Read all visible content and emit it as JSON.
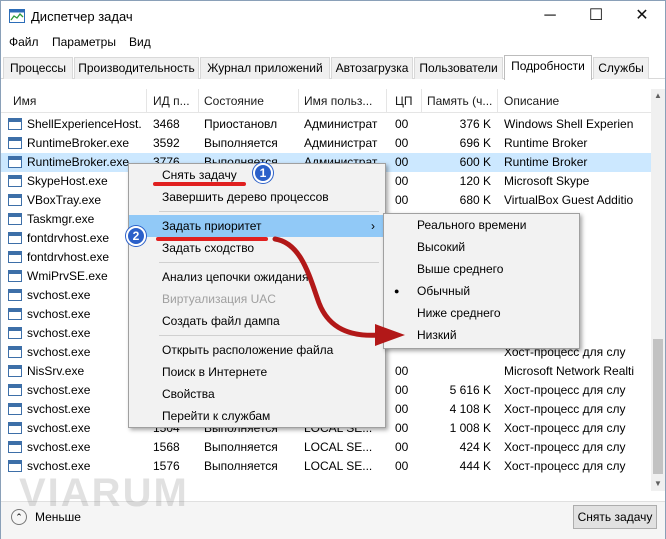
{
  "window": {
    "title": "Диспетчер задач",
    "minimize": "─",
    "maximize": "☐",
    "close": "✕"
  },
  "menu": [
    "Файл",
    "Параметры",
    "Вид"
  ],
  "tabs": [
    "Процессы",
    "Производительность",
    "Журнал приложений",
    "Автозагрузка",
    "Пользователи",
    "Подробности",
    "Службы"
  ],
  "active_tab": "Подробности",
  "columns": [
    "Имя",
    "ИД п...",
    "Состояние",
    "Имя польз...",
    "ЦП",
    "Память (ч...",
    "Описание"
  ],
  "rows": [
    {
      "name": "ShellExperienceHost.",
      "pid": "3468",
      "state": "Приостановл",
      "user": "Администрат",
      "cpu": "00",
      "mem": "376 K",
      "desc": "Windows Shell Experien"
    },
    {
      "name": "RuntimeBroker.exe",
      "pid": "3592",
      "state": "Выполняется",
      "user": "Администрат",
      "cpu": "00",
      "mem": "696 K",
      "desc": "Runtime Broker"
    },
    {
      "name": "RuntimeBroker.exe",
      "pid": "3776",
      "state": "Выполняется",
      "user": "Администрат",
      "cpu": "00",
      "mem": "600 K",
      "desc": "Runtime Broker"
    },
    {
      "name": "SkypeHost.exe",
      "pid": "",
      "state": "",
      "user": "",
      "cpu": "00",
      "mem": "120 K",
      "desc": "Microsoft Skype"
    },
    {
      "name": "VBoxTray.exe",
      "pid": "",
      "state": "",
      "user": "",
      "cpu": "00",
      "mem": "680 K",
      "desc": "VirtualBox Guest Additio"
    },
    {
      "name": "Taskmgr.exe",
      "pid": "",
      "state": "",
      "user": "",
      "cpu": "",
      "mem": "",
      "desc": "ер задач"
    },
    {
      "name": "fontdrvhost.exe",
      "pid": "",
      "state": "",
      "user": "",
      "cpu": "",
      "mem": "",
      "desc": "Driver H"
    },
    {
      "name": "fontdrvhost.exe",
      "pid": "",
      "state": "",
      "user": "",
      "cpu": "",
      "mem": "",
      "desc": "Driver H"
    },
    {
      "name": "WmiPrvSE.exe",
      "pid": "",
      "state": "",
      "user": "",
      "cpu": "",
      "mem": "",
      "desc": "Host"
    },
    {
      "name": "svchost.exe",
      "pid": "",
      "state": "",
      "user": "",
      "cpu": "",
      "mem": "",
      "desc": "сс для слу"
    },
    {
      "name": "svchost.exe",
      "pid": "",
      "state": "",
      "user": "",
      "cpu": "",
      "mem": "",
      "desc": "сс для слу"
    },
    {
      "name": "svchost.exe",
      "pid": "",
      "state": "",
      "user": "",
      "cpu": "",
      "mem": "",
      "desc": "сс для слу"
    },
    {
      "name": "svchost.exe",
      "pid": "",
      "state": "",
      "user": "",
      "cpu": "",
      "mem": "",
      "desc": "Хост-процесс для слу"
    },
    {
      "name": "NisSrv.exe",
      "pid": "",
      "state": "",
      "user": "",
      "cpu": "00",
      "mem": "",
      "desc": "Microsoft Network Realti"
    },
    {
      "name": "svchost.exe",
      "pid": "",
      "state": "",
      "user": "",
      "cpu": "00",
      "mem": "5 616 K",
      "desc": "Хост-процесс для слу"
    },
    {
      "name": "svchost.exe",
      "pid": "",
      "state": "",
      "user": "",
      "cpu": "00",
      "mem": "4 108 K",
      "desc": "Хост-процесс для слу"
    },
    {
      "name": "svchost.exe",
      "pid": "1504",
      "state": "Выполняется",
      "user": "LOCAL SE...",
      "cpu": "00",
      "mem": "1 008 K",
      "desc": "Хост-процесс для слу"
    },
    {
      "name": "svchost.exe",
      "pid": "1568",
      "state": "Выполняется",
      "user": "LOCAL SE...",
      "cpu": "00",
      "mem": "424 K",
      "desc": "Хост-процесс для слу"
    },
    {
      "name": "svchost.exe",
      "pid": "1576",
      "state": "Выполняется",
      "user": "LOCAL SE...",
      "cpu": "00",
      "mem": "444 K",
      "desc": "Хост-процесс для слу"
    }
  ],
  "context_menu": {
    "end_task": "Снять задачу",
    "end_tree": "Завершить дерево процессов",
    "set_priority": "Задать приоритет",
    "submenu_arrow": "›",
    "set_affinity": "Задать сходство",
    "wait_chain": "Анализ цепочки ожидания",
    "uac_virt": "Виртуализация UAC",
    "dump": "Создать файл дампа",
    "open_location": "Открыть расположение файла",
    "search_online": "Поиск в Интернете",
    "properties": "Свойства",
    "go_services": "Перейти к службам"
  },
  "priority_menu": {
    "realtime": "Реального времени",
    "high": "Высокий",
    "above_normal": "Выше среднего",
    "normal": "Обычный",
    "below_normal": "Ниже среднего",
    "low": "Низкий",
    "selected_marker": "●"
  },
  "badges": {
    "one": "1",
    "two": "2"
  },
  "footer": {
    "less": "Меньше",
    "less_icon": "⌃",
    "end_task_button": "Снять задачу"
  },
  "watermark": "VIARUM",
  "scroll": {
    "up": "▲",
    "down": "▼"
  },
  "colors": {
    "selected_row": "#cce8ff",
    "menu_highlight": "#91c9f7",
    "annotation_red": "#e02020",
    "arrow_red": "#b21818",
    "badge_blue": "#2b60c9"
  }
}
